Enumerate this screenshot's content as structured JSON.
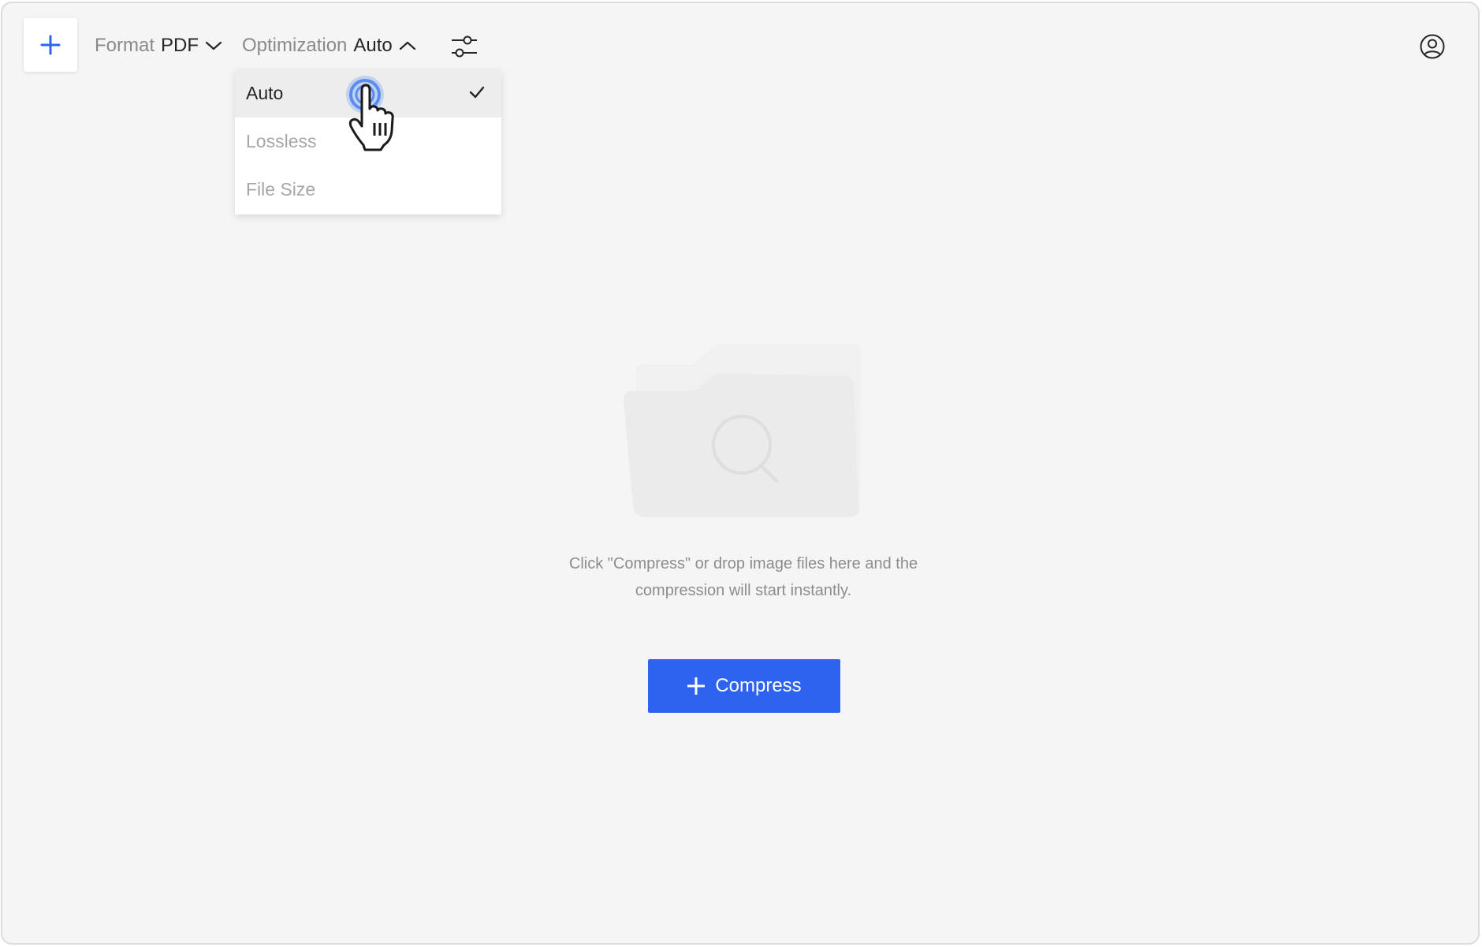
{
  "toolbar": {
    "add_icon": "plus-icon",
    "format_label": "Format",
    "format_value": "PDF",
    "optimization_label": "Optimization",
    "optimization_value": "Auto",
    "settings_icon": "sliders-icon",
    "account_icon": "user-circle-icon"
  },
  "optimization_menu": {
    "items": [
      {
        "label": "Auto",
        "selected": true
      },
      {
        "label": "Lossless",
        "selected": false
      },
      {
        "label": "File Size",
        "selected": false
      }
    ]
  },
  "empty_state": {
    "illustration_icon": "folder-search-icon",
    "hint_line1": "Click \"Compress\" or drop image files here and the",
    "hint_line2": "compression will start instantly."
  },
  "compress_button": {
    "label": "Compress",
    "icon": "plus-icon"
  },
  "colors": {
    "accent": "#2e63ef",
    "background": "#f5f5f5"
  }
}
